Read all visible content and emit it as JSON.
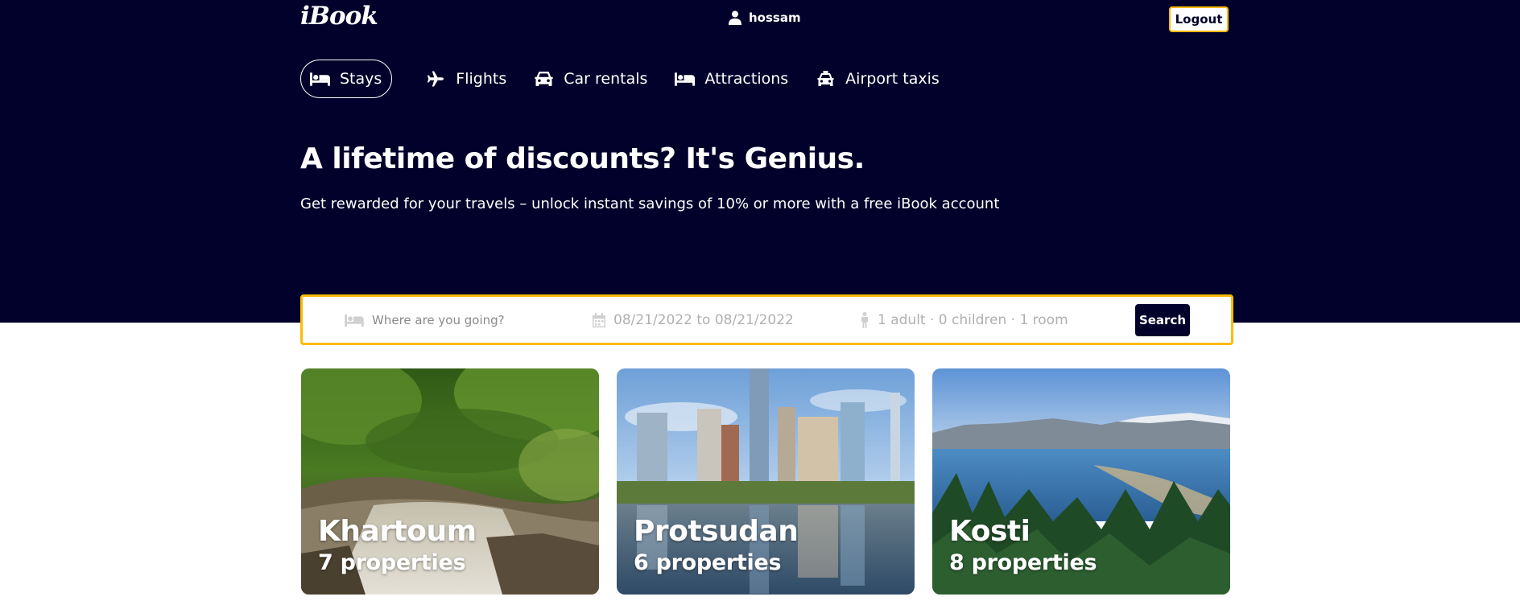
{
  "header": {
    "logo": "iBook",
    "username": "hossam",
    "logout_label": "Logout"
  },
  "nav": {
    "items": [
      {
        "label": "Stays",
        "icon": "bed-icon",
        "active": true
      },
      {
        "label": "Flights",
        "icon": "plane-icon",
        "active": false
      },
      {
        "label": "Car rentals",
        "icon": "car-icon",
        "active": false
      },
      {
        "label": "Attractions",
        "icon": "bed-icon",
        "active": false
      },
      {
        "label": "Airport taxis",
        "icon": "taxi-icon",
        "active": false
      }
    ]
  },
  "hero": {
    "title": "A lifetime of discounts? It's Genius.",
    "subtitle": "Get rewarded for your travels – unlock instant savings of 10% or more with a free iBook account"
  },
  "search": {
    "destination_placeholder": "Where are you going?",
    "date_range": "08/21/2022 to 08/21/2022",
    "guests": "1 adult · 0 children · 1 room",
    "button_label": "Search"
  },
  "featured": [
    {
      "city": "Khartoum",
      "properties": "7 properties",
      "image": "waterfall-forest-photo"
    },
    {
      "city": "Protsudan",
      "properties": "6 properties",
      "image": "city-skyline-photo"
    },
    {
      "city": "Kosti",
      "properties": "8 properties",
      "image": "lake-mountains-photo"
    }
  ],
  "colors": {
    "brand_dark": "#02012b",
    "accent_yellow": "#febb02",
    "white": "#ffffff"
  }
}
